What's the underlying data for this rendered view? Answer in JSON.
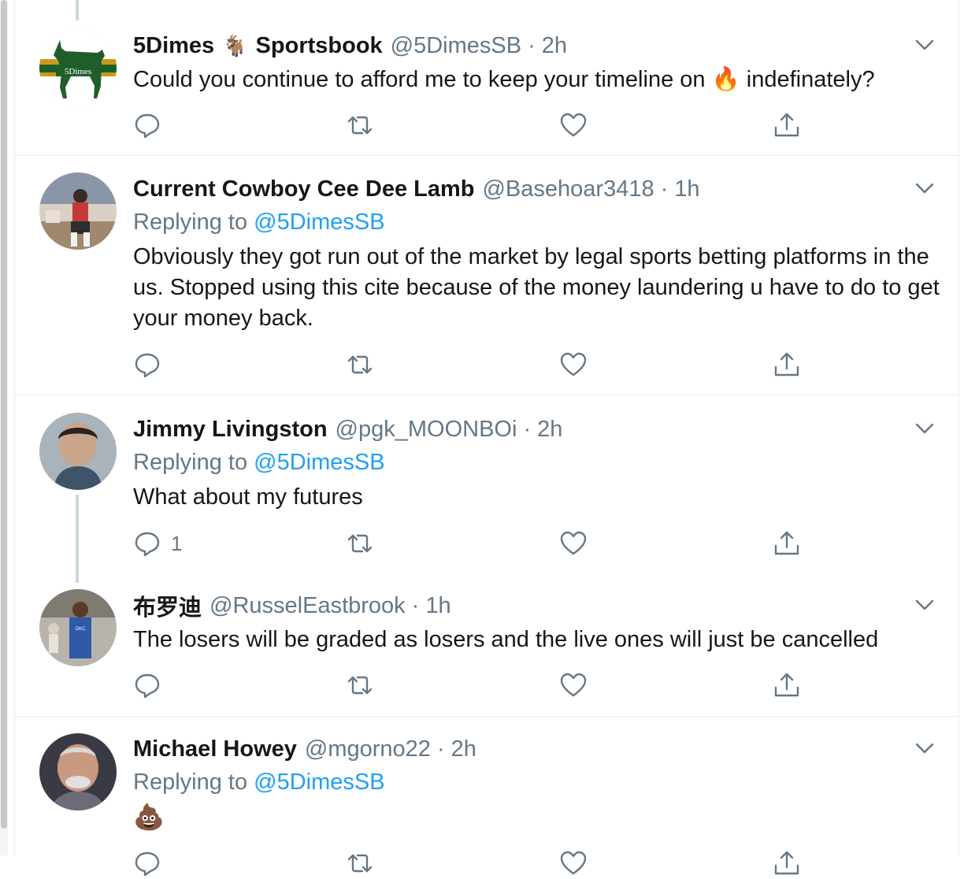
{
  "tweets": [
    {
      "display_name": "5Dimes",
      "display_name_suffix": "Sportsbook",
      "name_emoji": "🐐",
      "handle": "@5DimesSB",
      "separator": "·",
      "time": "2h",
      "text_before_emoji": "Could you continue to afford me to keep your timeline on ",
      "text_emoji": "🔥",
      "text_after_emoji": " indefinately?",
      "avatar_label": "5Dimes",
      "reply_count": ""
    },
    {
      "display_name": "Current Cowboy Cee Dee Lamb",
      "handle": "@Basehoar3418",
      "separator": "·",
      "time": "1h",
      "replying_prefix": "Replying to ",
      "replying_to": "@5DimesSB",
      "text": "Obviously they got run out of the market by legal sports betting platforms in the us. Stopped using this cite because of the money laundering u have to do to get your money back.",
      "reply_count": ""
    },
    {
      "display_name": "Jimmy Livingston",
      "handle": "@pgk_MOONBOi",
      "separator": "·",
      "time": "2h",
      "replying_prefix": "Replying to ",
      "replying_to": "@5DimesSB",
      "text": "What about my futures",
      "reply_count": "1"
    },
    {
      "display_name": "布罗迪",
      "handle": "@RusselEastbrook",
      "separator": "·",
      "time": "1h",
      "text": "The losers will be graded as losers and the live ones will just be cancelled",
      "reply_count": ""
    },
    {
      "display_name": "Michael Howey",
      "handle": "@mgorno22",
      "separator": "·",
      "time": "2h",
      "replying_prefix": "Replying to ",
      "replying_to": "@5DimesSB",
      "text": "💩",
      "reply_count": ""
    }
  ],
  "icons": {
    "reply": "reply-icon",
    "retweet": "retweet-icon",
    "like": "heart-icon",
    "share": "share-icon",
    "caret": "chevron-down-icon"
  },
  "colors": {
    "link": "#1da1f2",
    "secondary": "#657786",
    "primary_text": "#14171a",
    "border": "#e6ecf0",
    "thread_line": "#ccd6dd"
  }
}
